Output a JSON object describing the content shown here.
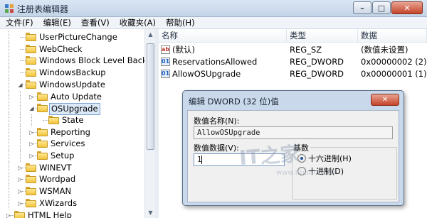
{
  "window": {
    "title": "注册表编辑器",
    "controls": {
      "minimize": "–",
      "maximize": "□",
      "close": "✕"
    }
  },
  "menu": [
    "文件(F)",
    "编辑(E)",
    "查看(V)",
    "收藏夹(A)",
    "帮助(H)"
  ],
  "tree": {
    "nodes": [
      {
        "label": "UserPictureChange",
        "depth": 2,
        "expander": "none"
      },
      {
        "label": "WebCheck",
        "depth": 2,
        "expander": "none"
      },
      {
        "label": "Windows Block Level Backup",
        "depth": 2,
        "expander": "none"
      },
      {
        "label": "WindowsBackup",
        "depth": 2,
        "expander": "none"
      },
      {
        "label": "WindowsUpdate",
        "depth": 2,
        "expander": "expanded"
      },
      {
        "label": "Auto Update",
        "depth": 3,
        "expander": "collapsed"
      },
      {
        "label": "OSUpgrade",
        "depth": 3,
        "expander": "expanded",
        "selected": true
      },
      {
        "label": "State",
        "depth": 4,
        "expander": "none"
      },
      {
        "label": "Reporting",
        "depth": 3,
        "expander": "collapsed"
      },
      {
        "label": "Services",
        "depth": 3,
        "expander": "collapsed"
      },
      {
        "label": "Setup",
        "depth": 3,
        "expander": "collapsed"
      },
      {
        "label": "WINEVT",
        "depth": 2,
        "expander": "collapsed"
      },
      {
        "label": "Wordpad",
        "depth": 2,
        "expander": "collapsed"
      },
      {
        "label": "WSMAN",
        "depth": 2,
        "expander": "collapsed"
      },
      {
        "label": "XWizards",
        "depth": 2,
        "expander": "collapsed"
      },
      {
        "label": "HTML Help",
        "depth": 1,
        "expander": "collapsed"
      }
    ]
  },
  "list": {
    "headers": {
      "name": "名称",
      "type": "类型",
      "data": "数据"
    },
    "rows": [
      {
        "icon": "string-value-icon",
        "icon_text": "ab",
        "name": "(默认)",
        "type": "REG_SZ",
        "data": "(数值未设置)"
      },
      {
        "icon": "dword-value-icon",
        "icon_text": "01",
        "name": "ReservationsAllowed",
        "type": "REG_DWORD",
        "data": "0x00000002 (2)"
      },
      {
        "icon": "dword-value-icon",
        "icon_text": "01",
        "name": "AllowOSUpgrade",
        "type": "REG_DWORD",
        "data": "0x00000001 (1)"
      }
    ]
  },
  "dialog": {
    "title": "编辑 DWORD (32 位)值",
    "close": "✕",
    "value_name_label": "数值名称(N):",
    "value_name": "AllowOSUpgrade",
    "value_data_label": "数值数据(V):",
    "value_data": "1",
    "base_label": "基数",
    "base_options": [
      {
        "label": "十六进制(H)",
        "selected": true
      },
      {
        "label": "十进制(D)",
        "selected": false
      }
    ]
  },
  "watermark": {
    "logo": "IT之家",
    "url": "www.ithome.com"
  }
}
